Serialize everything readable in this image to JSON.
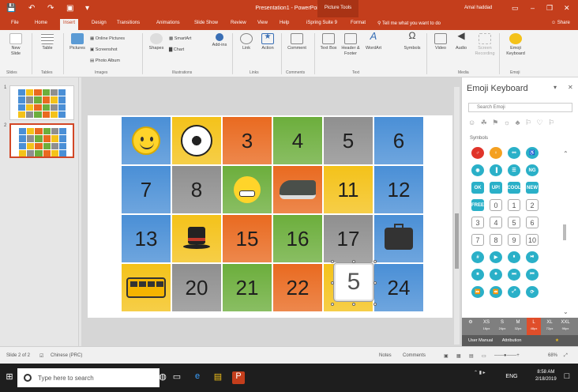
{
  "window": {
    "title": "Presentation1 - PowerPoint",
    "context_tab": "Picture Tools",
    "user": "Amal haddad"
  },
  "qat": {
    "save": "💾",
    "undo": "↶",
    "redo": "↷",
    "present": "▣",
    "more": "▾"
  },
  "window_controls": {
    "ribbon_display": "▭",
    "minimize": "–",
    "restore": "❒",
    "close": "✕"
  },
  "tabs": [
    "File",
    "Home",
    "Insert",
    "Design",
    "Transitions",
    "Animations",
    "Slide Show",
    "Review",
    "View",
    "Help",
    "iSpring Suite 9",
    "Format"
  ],
  "active_tab": "Insert",
  "tell_me": "Tell me what you want to do",
  "share": "Share",
  "ribbon": {
    "new_slide": "New Slide",
    "table": "Table",
    "pictures": "Pictures",
    "online_pictures": "Online Pictures",
    "screenshot": "Screenshot",
    "photo_album": "Photo Album",
    "shapes": "Shapes",
    "smartart": "SmartArt",
    "chart": "Chart",
    "addins": "Add-ins",
    "link": "Link",
    "action": "Action",
    "comment": "Comment",
    "text_box": "Text Box",
    "header_footer": "Header & Footer",
    "wordart": "WordArt",
    "symbols": "Symbols",
    "video": "Video",
    "audio": "Audio",
    "screen_recording": "Screen Recording",
    "emoji_keyboard": "Emoji Keyboard",
    "groups": [
      "Slides",
      "Tables",
      "Images",
      "Illustrations",
      "Links",
      "Comments",
      "Text",
      "Media",
      "Emoji"
    ]
  },
  "thumbnails": [
    {
      "num": "1"
    },
    {
      "num": "2"
    }
  ],
  "grid": [
    [
      "smile",
      "soccer",
      "3",
      "4",
      "5",
      "6"
    ],
    [
      "7",
      "8",
      "grimace",
      "shoe",
      "11",
      "12"
    ],
    [
      "13",
      "hat",
      "15",
      "16",
      "17",
      "briefcase"
    ],
    [
      "bus",
      "20",
      "21",
      "22",
      "5sel",
      "24"
    ]
  ],
  "grid_colors": [
    [
      "#4a8fd6",
      "#f4c21a",
      "#e96a20",
      "#6cae3c",
      "#8f8f8f",
      "#4a8fd6"
    ],
    [
      "#4a8fd6",
      "#8f8f8f",
      "#6cae3c",
      "#e96a20",
      "#f4c21a",
      "#4a8fd6"
    ],
    [
      "#4a8fd6",
      "#f4c21a",
      "#e96a20",
      "#6cae3c",
      "#8f8f8f",
      "#4a8fd6"
    ],
    [
      "#f4c21a",
      "#8f8f8f",
      "#6cae3c",
      "#e96a20",
      "#f4c21a",
      "#4a8fd6"
    ]
  ],
  "selected_emoji": "5",
  "emoji_pane": {
    "title": "Emoji Keyboard",
    "search_placeholder": "Search Emoji",
    "category": "Symbols",
    "categories": "☺ ☘ ⚑ ☼ ♣ ⚐ ♡ ⚐",
    "rows": [
      [
        {
          "t": "♂",
          "c": "#e0342a"
        },
        {
          "t": "♀",
          "c": "#f4a020"
        },
        {
          "t": "⚯",
          "c": "#2ab0c8"
        },
        {
          "t": "♿",
          "c": "#2ab0c8"
        }
      ],
      [
        {
          "t": "◉",
          "c": "#2ab0c8"
        },
        {
          "t": "▐",
          "c": "#2ab0c8"
        },
        {
          "t": "☰",
          "c": "#2ab0c8"
        },
        {
          "t": "NG",
          "c": "#2ab0c8"
        }
      ],
      [
        {
          "t": "OK",
          "c": "#2ab0c8"
        },
        {
          "t": "UP!",
          "c": "#2ab0c8"
        },
        {
          "t": "COOL",
          "c": "#2ab0c8"
        },
        {
          "t": "NEW",
          "c": "#2ab0c8"
        }
      ],
      [
        {
          "t": "FREE",
          "c": "#2ab0c8"
        },
        {
          "t": "0",
          "c": "num"
        },
        {
          "t": "1",
          "c": "num"
        },
        {
          "t": "2",
          "c": "num"
        }
      ],
      [
        {
          "t": "3",
          "c": "num"
        },
        {
          "t": "4",
          "c": "num"
        },
        {
          "t": "5",
          "c": "num"
        },
        {
          "t": "6",
          "c": "num"
        }
      ],
      [
        {
          "t": "7",
          "c": "num"
        },
        {
          "t": "8",
          "c": "num"
        },
        {
          "t": "9",
          "c": "num"
        },
        {
          "t": "10",
          "c": "num"
        }
      ],
      [
        {
          "t": "#",
          "c": "#2ab0c8"
        },
        {
          "t": "▶",
          "c": "#2ab0c8"
        },
        {
          "t": "⏸",
          "c": "#2ab0c8"
        },
        {
          "t": "⏯",
          "c": "#2ab0c8"
        }
      ],
      [
        {
          "t": "⏹",
          "c": "#2ab0c8"
        },
        {
          "t": "⏺",
          "c": "#2ab0c8"
        },
        {
          "t": "⏭",
          "c": "#2ab0c8"
        },
        {
          "t": "⏮",
          "c": "#2ab0c8"
        }
      ],
      [
        {
          "t": "⏩",
          "c": "#2ab0c8"
        },
        {
          "t": "⏪",
          "c": "#2ab0c8"
        },
        {
          "t": "⤢",
          "c": "#2ab0c8"
        },
        {
          "t": "⟳",
          "c": "#2ab0c8"
        }
      ]
    ],
    "sizes": [
      {
        "l": "XS",
        "p": "16px"
      },
      {
        "l": "S",
        "p": "24px"
      },
      {
        "l": "M",
        "p": "32px"
      },
      {
        "l": "L",
        "p": "48px"
      },
      {
        "l": "XL",
        "p": "72px"
      },
      {
        "l": "XXL",
        "p": "96px"
      }
    ],
    "active_size": "L",
    "user_manual": "User Manual",
    "attribution": "Attribution",
    "star": "★"
  },
  "status": {
    "slide": "Slide 2 of 2",
    "language": "Chinese (PRC)",
    "notes": "Notes",
    "comments": "Comments",
    "zoom": "68%"
  },
  "taskbar": {
    "search_placeholder": "Type here to search",
    "time": "8:58 AM",
    "date": "2/18/2019",
    "lang": "ENG"
  }
}
